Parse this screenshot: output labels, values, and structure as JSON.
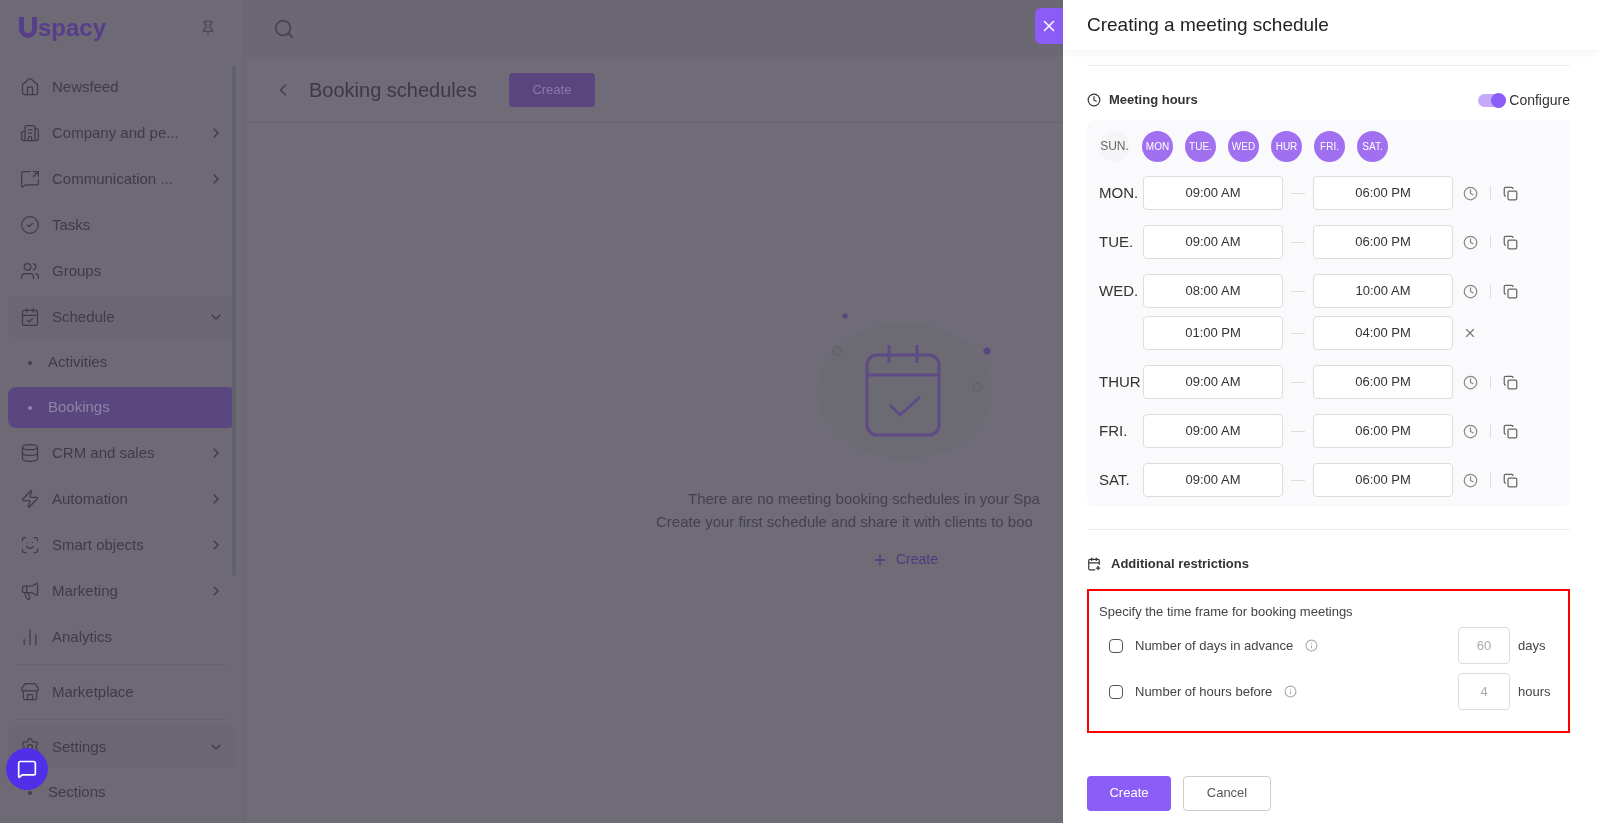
{
  "sidebar": {
    "logo": "spacy",
    "items": [
      {
        "label": "Newsfeed",
        "kind": "link",
        "selected": false
      },
      {
        "label": "Company and pe...",
        "kind": "group",
        "selected": false
      },
      {
        "label": "Communication ...",
        "kind": "group",
        "selected": false
      },
      {
        "label": "Tasks",
        "kind": "link",
        "selected": false
      },
      {
        "label": "Groups",
        "kind": "link",
        "selected": false
      },
      {
        "label": "Schedule",
        "kind": "open_group",
        "selected": false
      },
      {
        "label": "Activities",
        "kind": "subitem",
        "selected": false
      },
      {
        "label": "Bookings",
        "kind": "subitem",
        "selected": true
      },
      {
        "label": "CRM and sales",
        "kind": "group",
        "selected": false
      },
      {
        "label": "Automation",
        "kind": "group",
        "selected": false
      },
      {
        "label": "Smart objects",
        "kind": "group",
        "selected": false
      },
      {
        "label": "Marketing",
        "kind": "group",
        "selected": false
      },
      {
        "label": "Analytics",
        "kind": "link",
        "selected": false
      },
      {
        "label": "Marketplace",
        "kind": "link",
        "selected": false
      },
      {
        "label": "Settings",
        "kind": "open_group",
        "selected": false
      },
      {
        "label": "Sections",
        "kind": "subitem",
        "selected": false
      }
    ]
  },
  "page": {
    "title": "Booking schedules",
    "create_button": "Create",
    "empty_lines": [
      "There are no meeting booking schedules in your Spa",
      "Create your first schedule and share it with clients to boo"
    ],
    "empty_create": "Create"
  },
  "panel": {
    "title": "Creating a meeting schedule",
    "meeting_hours": {
      "title": "Meeting hours",
      "configure": {
        "label": "Configure",
        "on": true
      },
      "days": [
        {
          "label": "SUN.",
          "selected": false
        },
        {
          "label": "MON",
          "selected": true
        },
        {
          "label": "TUE.",
          "selected": true
        },
        {
          "label": "WED",
          "selected": true
        },
        {
          "label": "HUR",
          "selected": true
        },
        {
          "label": "FRI.",
          "selected": true
        },
        {
          "label": "SAT.",
          "selected": true
        }
      ],
      "rows": [
        {
          "day": "MON.",
          "intervals": [
            [
              "09:00 AM",
              "06:00 PM"
            ]
          ]
        },
        {
          "day": "TUE.",
          "intervals": [
            [
              "09:00 AM",
              "06:00 PM"
            ]
          ]
        },
        {
          "day": "WED.",
          "intervals": [
            [
              "08:00 AM",
              "10:00 AM"
            ],
            [
              "01:00 PM",
              "04:00 PM"
            ]
          ]
        },
        {
          "day": "THUR",
          "intervals": [
            [
              "09:00 AM",
              "06:00 PM"
            ]
          ]
        },
        {
          "day": "FRI.",
          "intervals": [
            [
              "09:00 AM",
              "06:00 PM"
            ]
          ]
        },
        {
          "day": "SAT.",
          "intervals": [
            [
              "09:00 AM",
              "06:00 PM"
            ]
          ]
        }
      ]
    },
    "restrictions": {
      "title": "Additional restrictions",
      "hint": "Specify the time frame for booking meetings",
      "options": [
        {
          "label": "Number of days in advance",
          "checked": false,
          "placeholder": "60",
          "unit": "days"
        },
        {
          "label": "Number of hours before",
          "checked": false,
          "placeholder": "4",
          "unit": "hours"
        }
      ]
    },
    "buttons": {
      "create": "Create",
      "cancel": "Cancel"
    }
  }
}
